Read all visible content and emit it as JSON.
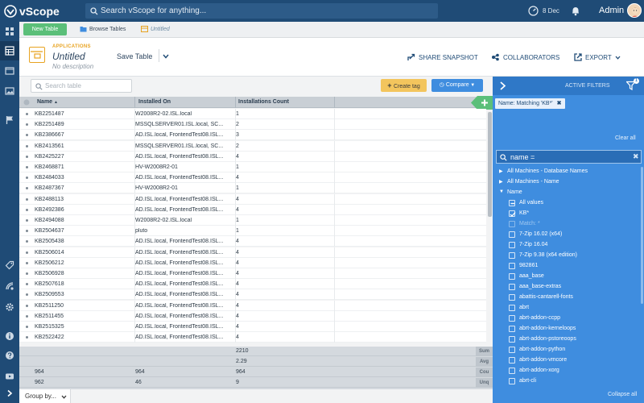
{
  "topbar": {
    "logo_text": "vScope",
    "search_placeholder": "Search vScope for anything...",
    "date": "8 Dec",
    "user": "Admin"
  },
  "tabs": {
    "new_table": "New Table",
    "browse_tables": "Browse Tables",
    "untitled": "Untitled"
  },
  "header": {
    "category": "APPLICATIONS",
    "title": "Untitled",
    "description": "No description",
    "save_table": "Save Table",
    "share_snapshot": "SHARE SNAPSHOT",
    "collaborators": "COLLABORATORS",
    "export": "EXPORT"
  },
  "table": {
    "search_placeholder": "Search table",
    "create_tag": "Create tag",
    "compare": "Compare",
    "columns": [
      "Name",
      "Installed On",
      "Installations Count"
    ],
    "rows": [
      [
        "KB2251487",
        "W2008R2-02.ISL.local",
        "1"
      ],
      [
        "KB2251489",
        "MSSQLSERVER01.ISL.local, SC...",
        "2"
      ],
      [
        "KB2386667",
        "AD.ISL.local, FrontendTest08.ISL...",
        "3"
      ],
      [
        "KB2413561",
        "MSSQLSERVER01.ISL.local, SC...",
        "2"
      ],
      [
        "KB2425227",
        "AD.ISL.local, FrontendTest08.ISL...",
        "4"
      ],
      [
        "KB2468871",
        "HV-W2008R2-01",
        "1"
      ],
      [
        "KB2484033",
        "AD.ISL.local, FrontendTest08.ISL...",
        "4"
      ],
      [
        "KB2487367",
        "HV-W2008R2-01",
        "1"
      ],
      [
        "KB2488113",
        "AD.ISL.local, FrontendTest08.ISL...",
        "4"
      ],
      [
        "KB2492386",
        "AD.ISL.local, FrontendTest08.ISL...",
        "4"
      ],
      [
        "KB2494088",
        "W2008R2-02.ISL.local",
        "1"
      ],
      [
        "KB2504637",
        "pluto",
        "1"
      ],
      [
        "KB2505438",
        "AD.ISL.local, FrontendTest08.ISL...",
        "4"
      ],
      [
        "KB2506014",
        "AD.ISL.local, FrontendTest08.ISL...",
        "4"
      ],
      [
        "KB2506212",
        "AD.ISL.local, FrontendTest08.ISL...",
        "4"
      ],
      [
        "KB2506928",
        "AD.ISL.local, FrontendTest08.ISL...",
        "4"
      ],
      [
        "KB2507618",
        "AD.ISL.local, FrontendTest08.ISL...",
        "4"
      ],
      [
        "KB2509553",
        "AD.ISL.local, FrontendTest08.ISL...",
        "4"
      ],
      [
        "KB2511250",
        "AD.ISL.local, FrontendTest08.ISL...",
        "4"
      ],
      [
        "KB2511455",
        "AD.ISL.local, FrontendTest08.ISL...",
        "4"
      ],
      [
        "KB2515325",
        "AD.ISL.local, FrontendTest08.ISL...",
        "4"
      ],
      [
        "KB2522422",
        "AD.ISL.local, FrontendTest08.ISL...",
        "4"
      ]
    ],
    "footer": [
      {
        "label": "Sum",
        "c1": "",
        "c2": "",
        "c3": "2210"
      },
      {
        "label": "Avg",
        "c1": "",
        "c2": "",
        "c3": "2.29"
      },
      {
        "label": "Cou",
        "c1": "964",
        "c2": "964",
        "c3": "964"
      },
      {
        "label": "Unq",
        "c1": "962",
        "c2": "46",
        "c3": "9"
      }
    ],
    "group_by": "Group by..."
  },
  "filters": {
    "title": "ACTIVE FILTERS",
    "badge": "1",
    "chip": "Name: Matching 'KB*'",
    "clear_all": "Clear all",
    "search_value": "name =",
    "collapse_all": "Collapse all",
    "items": [
      {
        "type": "group",
        "label": "All Machines - Database Names",
        "expanded": false
      },
      {
        "type": "group",
        "label": "All Machines - Name",
        "expanded": false
      },
      {
        "type": "group",
        "label": "Name",
        "expanded": true
      },
      {
        "type": "check",
        "label": "All values",
        "state": "partial"
      },
      {
        "type": "check",
        "label": "KB*",
        "state": "checked"
      },
      {
        "type": "check",
        "label": "Match: *",
        "state": "none",
        "dim": true
      },
      {
        "type": "check",
        "label": "7-Zip 16.02 (x64)",
        "state": "none"
      },
      {
        "type": "check",
        "label": "7-Zip 16.04",
        "state": "none"
      },
      {
        "type": "check",
        "label": "7-Zip 9.38 (x64 edition)",
        "state": "none"
      },
      {
        "type": "check",
        "label": "982861",
        "state": "none"
      },
      {
        "type": "check",
        "label": "aaa_base",
        "state": "none"
      },
      {
        "type": "check",
        "label": "aaa_base-extras",
        "state": "none"
      },
      {
        "type": "check",
        "label": "abattis-cantarell-fonts",
        "state": "none"
      },
      {
        "type": "check",
        "label": "abrt",
        "state": "none"
      },
      {
        "type": "check",
        "label": "abrt-addon-ccpp",
        "state": "none"
      },
      {
        "type": "check",
        "label": "abrt-addon-kerneloops",
        "state": "none"
      },
      {
        "type": "check",
        "label": "abrt-addon-pstoreoops",
        "state": "none"
      },
      {
        "type": "check",
        "label": "abrt-addon-python",
        "state": "none"
      },
      {
        "type": "check",
        "label": "abrt-addon-vmcore",
        "state": "none"
      },
      {
        "type": "check",
        "label": "abrt-addon-xorg",
        "state": "none"
      },
      {
        "type": "check",
        "label": "abrt-cli",
        "state": "none"
      }
    ]
  },
  "colors": {
    "navy": "#1f4b76",
    "panel_blue": "#3f8ddf",
    "accent_green": "#5bbf79",
    "accent_orange": "#e8a321",
    "create_tag_yellow": "#f3c55d"
  }
}
